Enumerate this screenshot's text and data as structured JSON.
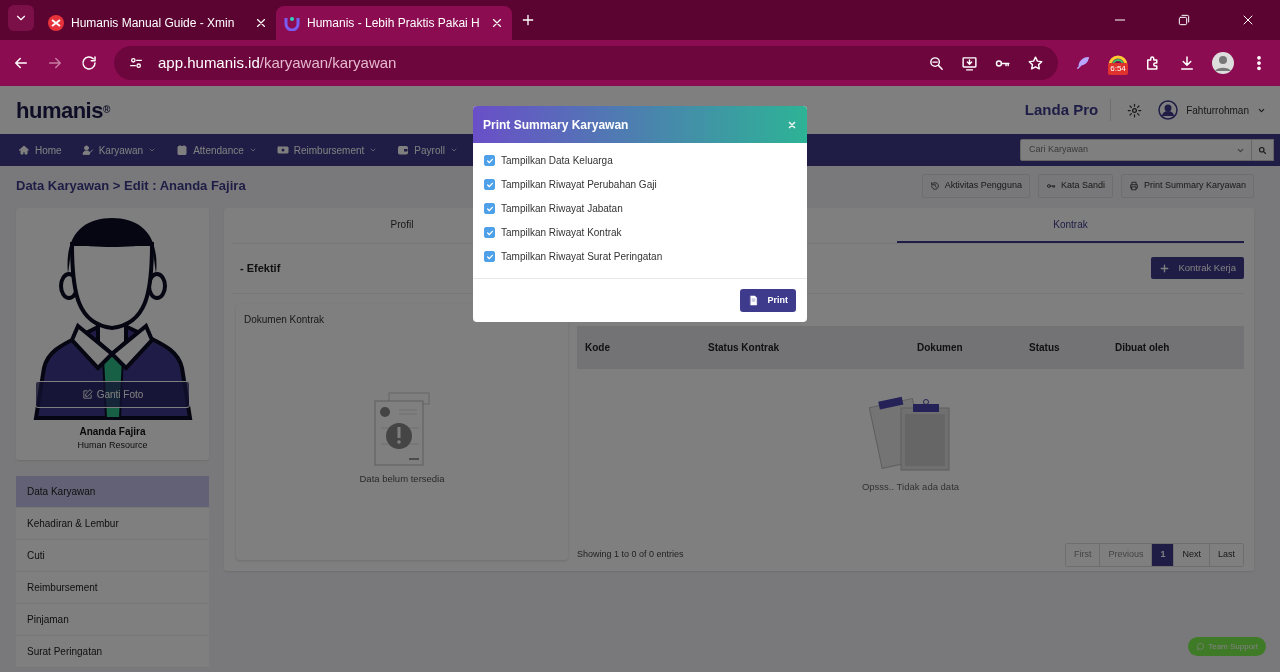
{
  "browser": {
    "tabs": [
      {
        "title": "Humanis Manual Guide - Xmin",
        "selected": false
      },
      {
        "title": "Humanis - Lebih Praktis Pakai H",
        "selected": true
      }
    ],
    "url_host": "app.humanis.id",
    "url_path": "/karyawan/karyawan",
    "extension_badge": "6:54"
  },
  "header": {
    "logo": "humanis$^{®}$",
    "company": "Landa Pro",
    "user": "Fahturrohman"
  },
  "nav": [
    {
      "label": "Home",
      "caret": false
    },
    {
      "label": "Karyawan",
      "caret": true
    },
    {
      "label": "Attendance",
      "caret": true
    },
    {
      "label": "Reimbursement",
      "caret": true
    },
    {
      "label": "Payroll",
      "caret": true
    }
  ],
  "search": {
    "placeholder": "Cari Karyawan"
  },
  "breadcrumb": "Data Karyawan > Edit : Ananda Fajira",
  "actions": [
    {
      "label": "Aktivitas Pengguna"
    },
    {
      "label": "Kata Sandi"
    },
    {
      "label": "Print Summary Karyawan"
    }
  ],
  "profile": {
    "change_photo": "Ganti Foto",
    "name": "Ananda Fajira",
    "role": "Human Resource"
  },
  "side_menu": [
    {
      "label": "Data Karyawan",
      "selected": true
    },
    {
      "label": "Kehadiran & Lembur",
      "selected": false
    },
    {
      "label": "Cuti",
      "selected": false
    },
    {
      "label": "Reimbursement",
      "selected": false
    },
    {
      "label": "Pinjaman",
      "selected": false
    },
    {
      "label": "Surat Peringatan",
      "selected": false
    }
  ],
  "tabs": [
    {
      "label": "Profil",
      "selected": false
    },
    {
      "label": "Kontrak",
      "selected": true
    }
  ],
  "section_title": "- Efektif",
  "add_button": "Kontrak Kerja",
  "document_card": {
    "title": "Dokumen Kontrak",
    "empty_text": "Data belum tersedia"
  },
  "table": {
    "columns": [
      "Kode",
      "Status Kontrak",
      "Dokumen",
      "Status",
      "Dibuat oleh"
    ],
    "empty_text": "Opsss.. Tidak ada data",
    "info": "Showing 1 to 0 of 0 entries"
  },
  "pagination": [
    {
      "label": "First",
      "disabled": true,
      "selected": false
    },
    {
      "label": "Previous",
      "disabled": true,
      "selected": false
    },
    {
      "label": "1",
      "disabled": false,
      "selected": true
    },
    {
      "label": "Next",
      "disabled": false,
      "selected": false
    },
    {
      "label": "Last",
      "disabled": false,
      "selected": false
    }
  ],
  "support_button": "Team Support",
  "modal": {
    "title": "Print Summary Karyawan",
    "options": [
      {
        "label": "Tampilkan Data Keluarga",
        "checked": true
      },
      {
        "label": "Tampilkan Riwayat Perubahan Gaji",
        "checked": true
      },
      {
        "label": "Tampilkan Riwayat Jabatan",
        "checked": true
      },
      {
        "label": "Tampilkan Riwayat Kontrak",
        "checked": true
      },
      {
        "label": "Tampilkan Riwayat Surat Peringatan",
        "checked": true
      }
    ],
    "print_button": "Print"
  }
}
